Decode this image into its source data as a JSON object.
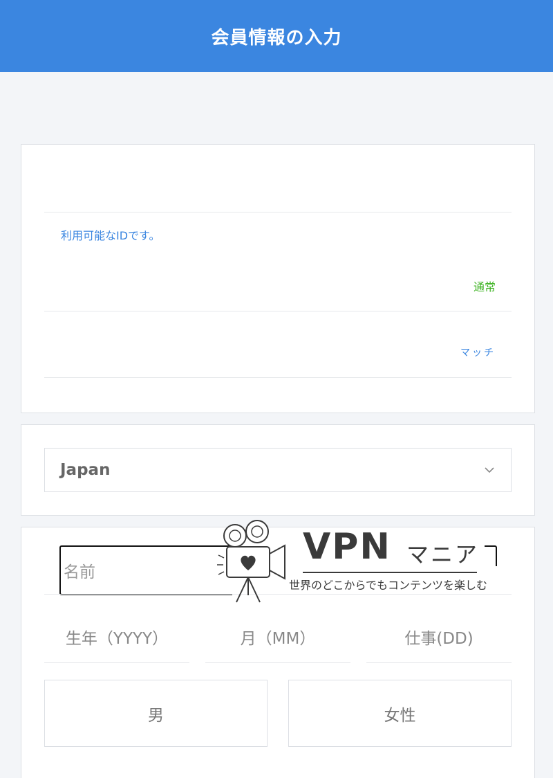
{
  "header": {
    "title": "会員情報の入力"
  },
  "account": {
    "id_value": "",
    "id_status": "利用可能なIDです。",
    "password_value": "",
    "password_strength": "通常",
    "password_confirm_value": "",
    "password_match": "マッチ"
  },
  "country": {
    "selected": "Japan"
  },
  "profile": {
    "name_placeholder": "名前",
    "birth_year_placeholder": "生年（YYYY）",
    "birth_month_placeholder": "月（MM）",
    "birth_day_placeholder": "仕事(DD)",
    "gender_male": "男",
    "gender_female": "女性"
  },
  "watermark": {
    "logo": "VPN",
    "logo_sub": "マニア",
    "tagline": "世界のどこからでもコンテンツを楽しむ"
  },
  "colors": {
    "header": "#3b86e0",
    "status_blue": "#3b86e0",
    "strength_green": "#3db322"
  }
}
